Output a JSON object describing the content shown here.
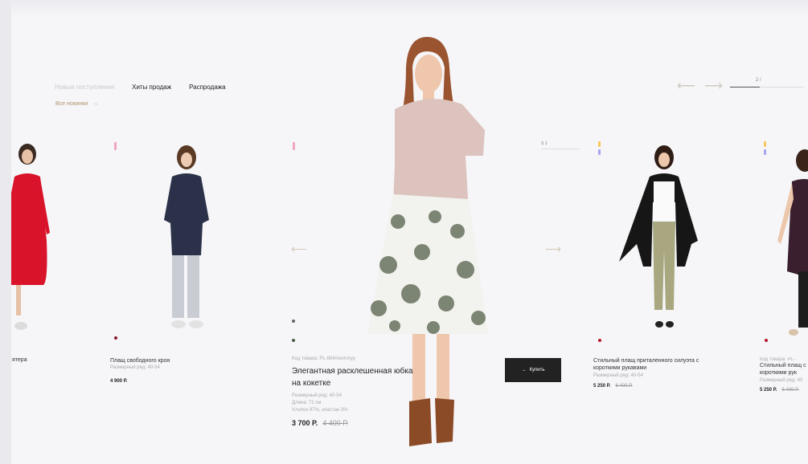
{
  "tabs": [
    {
      "label": "Новые поступления"
    },
    {
      "label": "Хиты продаж"
    },
    {
      "label": "Распродажа"
    }
  ],
  "see_all": {
    "label": "Все новинки"
  },
  "slider": {
    "counter": "2 /"
  },
  "products": [
    {
      "name": "ятера"
    },
    {
      "name": "Плащ свободного кроя",
      "meta": "Размерный ряд: 40-54",
      "price": "4 900 Р."
    },
    {
      "code": "Код товара: PL-684/nevinnyy",
      "name": "Элегантная расклешенная юбка на кокетке",
      "meta": [
        "Размерный ряд: 40-54",
        "Длина: 71 см",
        "Хлопок 97%, эластан 3%"
      ],
      "price": "3 700 Р.",
      "old_price": "4 400 Р."
    },
    {
      "name": "Стильный плащ приталенного силуэта с короткими рукавами",
      "meta": "Размерный ряд: 40-54",
      "price": "5 250 Р.",
      "old_price": "6 400 Р."
    },
    {
      "code": "Код товара: PL-",
      "name": "Стильный плащ с короткими рук",
      "meta": "Размерный ряд: 40",
      "price": "5 250 Р.",
      "old_price": "6 400 Р."
    }
  ],
  "buy_button": {
    "label": "Купить",
    "icon": "cart-icon"
  },
  "size_badge": "S 1",
  "colors": {
    "accent": "#b5926a",
    "button": "#222222",
    "red_dress": "#d8132a",
    "pink_top": "#dcc3bd",
    "navy_coat": "#2b3148",
    "khaki": "#a8a77f"
  }
}
